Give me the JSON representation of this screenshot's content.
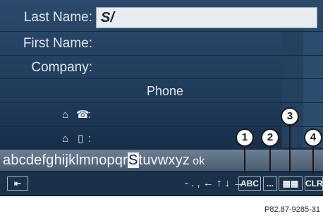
{
  "fields": {
    "last_name_label": "Last Name:",
    "last_name_value": "S/",
    "first_name_label": "First Name:",
    "company_label": "Company:"
  },
  "phone": {
    "title": "Phone",
    "home_phone_label": ":",
    "home_mobile_label": ":"
  },
  "keyboard": {
    "letters_before": "abcdefghijklmnopqr",
    "selected_letter": "S",
    "letters_after": "tuvwxyz",
    "end_key": "ok"
  },
  "bottom_bar": {
    "symbols": "- . , ← ↑ ↓ →",
    "abc_button": "ABC",
    "more_button": "...",
    "clr_button": "CLR"
  },
  "callouts": [
    "1",
    "2",
    "3",
    "4"
  ],
  "caption": "P82.87-9285-31",
  "colors": {
    "screen_bg": "#1f3957",
    "keyboard_bg": "#5c6e82",
    "highlight": "#eef1f4"
  }
}
